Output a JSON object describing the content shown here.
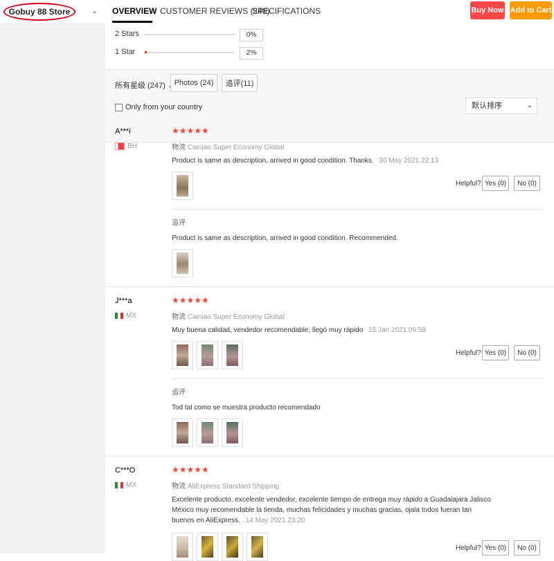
{
  "store": {
    "name": "Gobuy 88 Store"
  },
  "nav": {
    "tabs": [
      {
        "label": "OVERVIEW",
        "active": true
      },
      {
        "label": "CUSTOMER REVIEWS (248)"
      },
      {
        "label": "SPECIFICATIONS"
      }
    ],
    "buy_now": "Buy Now",
    "add_to_cart": "Add to Cart"
  },
  "colors": {
    "buy": "#ff4747",
    "cart": "#ff9a00",
    "star": "#f0463c"
  },
  "rating_breakdown": [
    {
      "label": "2 Stars",
      "percent": "0%",
      "fraction": 0
    },
    {
      "label": "1 Star",
      "percent": "2%",
      "fraction": 0.02
    }
  ],
  "filters": {
    "all_ratings": "所有星级 (247)",
    "photos": "Photos (24)",
    "followups": "追评(11)",
    "only_country": "Only from your country",
    "sort": "默认排序"
  },
  "reviews": [
    {
      "name": "A***i",
      "country": "BH",
      "logistics_label": "物流",
      "logistics": "Cainiao Super Economy Global",
      "text": "Product is same as description, arrived in good condition. Thanks.",
      "date": "30 May 2021 22:13",
      "helpful": "Helpful?",
      "yes": "Yes (0)",
      "no": "No (0)",
      "followup_label": "追评",
      "followup_text": "Product is same as description, arrived in good condition. Recommended."
    },
    {
      "name": "J***a",
      "country": "MX",
      "logistics_label": "物流",
      "logistics": "Cainiao Super Economy Global",
      "text": "Muy buena calidad, vendedor recomendable, llegó muy rápido",
      "date": "15 Jan 2021 09:58",
      "helpful": "Helpful?",
      "yes": "Yes (0)",
      "no": "No (0)",
      "followup_label": "追评",
      "followup_text": "Tod tal como se muestra producto recomendado"
    },
    {
      "name": "C***O",
      "country": "MX",
      "logistics_label": "物流",
      "logistics": "AliExpress Standard Shipping",
      "text": "Excelente producto, excelente vendedor, excelente tiempo de entrega muy rápido a Guadalajara Jalisco México muy recomendable la tienda, muchas felicidades y muchas gracias, ojala todos fueran tan buenos en AliExpress.",
      "date": "14 May 2021 23:20",
      "helpful": "Helpful?",
      "yes": "Yes (0)",
      "no": "No (0)"
    }
  ]
}
